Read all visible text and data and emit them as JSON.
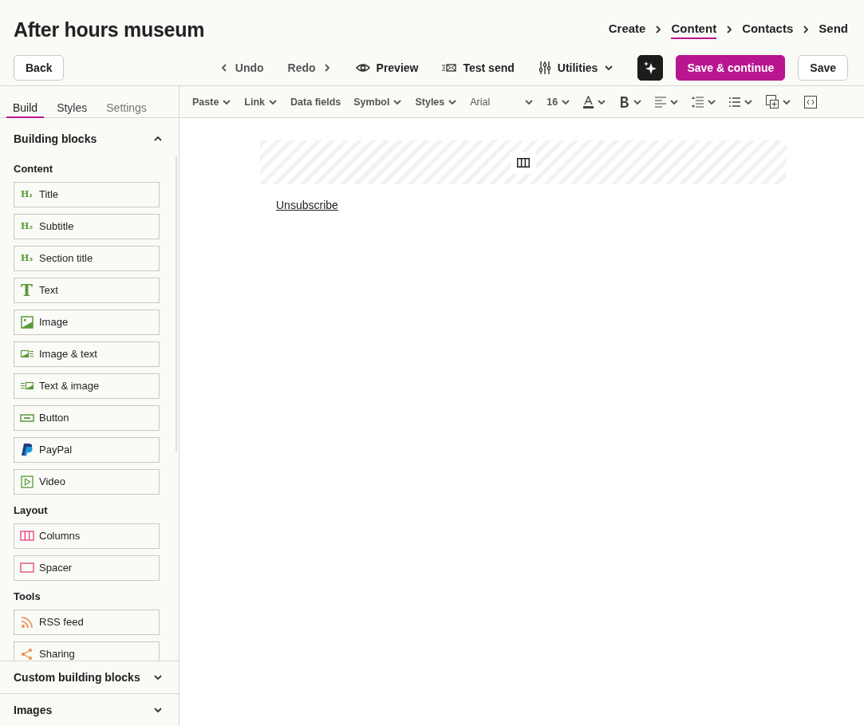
{
  "title": "After hours museum",
  "steps": [
    {
      "label": "Create",
      "selected": false
    },
    {
      "label": "Content",
      "selected": true
    },
    {
      "label": "Contacts",
      "selected": false
    },
    {
      "label": "Send",
      "selected": false
    }
  ],
  "actions": {
    "back": "Back",
    "undo": "Undo",
    "redo": "Redo",
    "preview": "Preview",
    "test_send": "Test send",
    "utilities": "Utilities",
    "save_continue": "Save & continue",
    "save": "Save"
  },
  "sidebar_tabs": [
    {
      "label": "Build",
      "selected": true
    },
    {
      "label": "Styles",
      "selected": false
    },
    {
      "label": "Settings",
      "selected": false
    }
  ],
  "building_blocks": {
    "title": "Building blocks",
    "expanded": true,
    "groups": [
      {
        "heading": "Content",
        "items": [
          {
            "label": "Title",
            "kind": "glyph",
            "glyph": "H₁"
          },
          {
            "label": "Subtitle",
            "kind": "glyph",
            "glyph": "H₂"
          },
          {
            "label": "Section title",
            "kind": "glyph",
            "glyph": "H₃"
          },
          {
            "label": "Text",
            "kind": "big-glyph",
            "glyph": "T"
          },
          {
            "label": "Image",
            "kind": "image"
          },
          {
            "label": "Image & text",
            "kind": "image-text"
          },
          {
            "label": "Text & image",
            "kind": "text-image"
          },
          {
            "label": "Button",
            "kind": "button"
          },
          {
            "label": "PayPal",
            "kind": "paypal"
          },
          {
            "label": "Video",
            "kind": "video"
          }
        ]
      },
      {
        "heading": "Layout",
        "items": [
          {
            "label": "Columns",
            "kind": "columns"
          },
          {
            "label": "Spacer",
            "kind": "spacer"
          }
        ]
      },
      {
        "heading": "Tools",
        "items": [
          {
            "label": "RSS feed",
            "kind": "rss"
          },
          {
            "label": "Sharing",
            "kind": "share"
          }
        ]
      }
    ]
  },
  "collapsed_sections": [
    {
      "title": "Custom building blocks",
      "expanded": false
    },
    {
      "title": "Images",
      "expanded": false
    }
  ],
  "toolbar": [
    {
      "kind": "menu",
      "label": "Paste"
    },
    {
      "kind": "menu",
      "label": "Link"
    },
    {
      "kind": "plain",
      "label": "Data fields"
    },
    {
      "kind": "menu",
      "label": "Symbol"
    },
    {
      "kind": "menu",
      "label": "Styles"
    },
    {
      "kind": "font",
      "label": "Arial"
    },
    {
      "kind": "menu",
      "label": "16"
    },
    {
      "kind": "text-color"
    },
    {
      "kind": "bold"
    },
    {
      "kind": "align"
    },
    {
      "kind": "line-spacing"
    },
    {
      "kind": "list"
    },
    {
      "kind": "insert"
    },
    {
      "kind": "source"
    }
  ],
  "canvas": {
    "blocks": [
      {
        "kind": "columns"
      },
      {
        "kind": "link",
        "label": "Unsubscribe"
      }
    ]
  }
}
